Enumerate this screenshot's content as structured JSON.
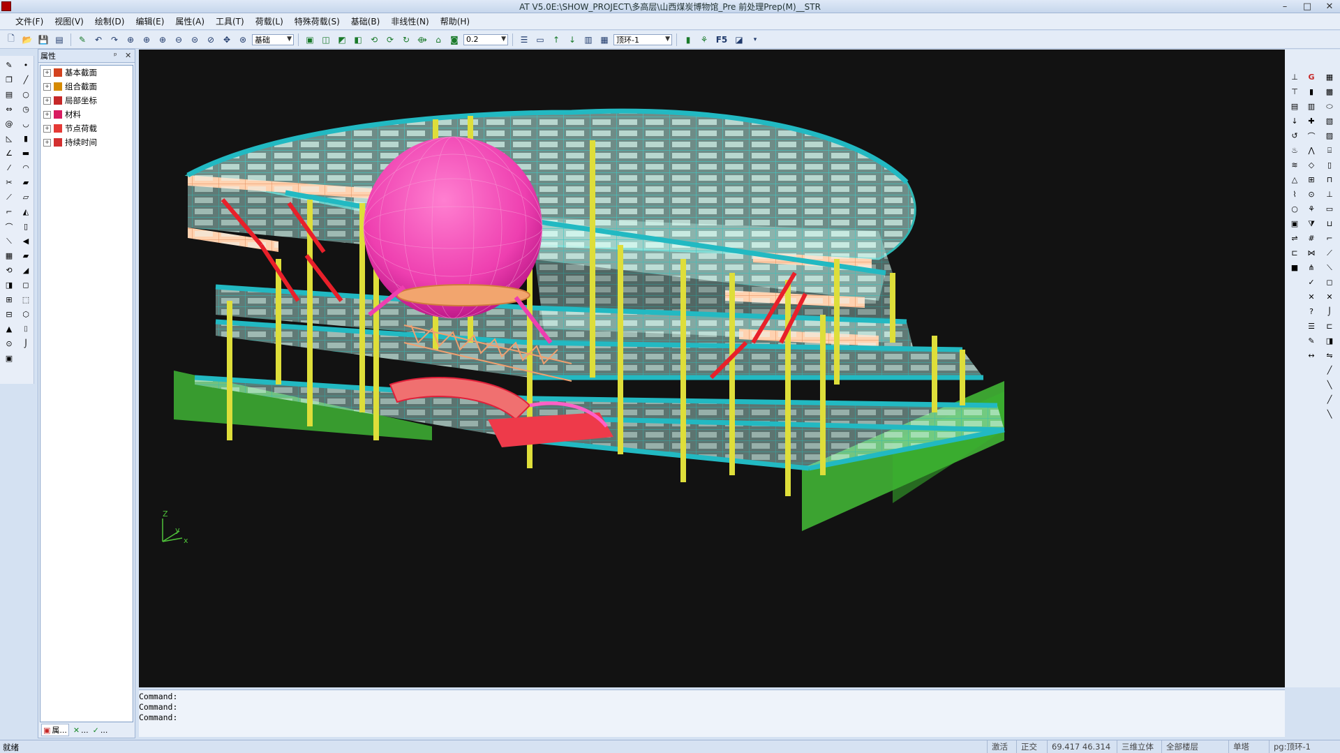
{
  "window": {
    "title": "AT V5.0E:\\SHOW_PROJECT\\多高层\\山西煤炭博物馆_Pre    前处理Prep(M)__STR",
    "controls": [
      "–",
      "□",
      "✕"
    ]
  },
  "menu": [
    "文件(F)",
    "视图(V)",
    "绘制(D)",
    "编辑(E)",
    "属性(A)",
    "工具(T)",
    "荷载(L)",
    "特殊荷载(S)",
    "基础(B)",
    "非线性(N)",
    "帮助(H)"
  ],
  "toolbar": {
    "view_combo": "基础",
    "scale_combo": "0.2",
    "floor_combo": "顶环-1",
    "f5_label": "F5"
  },
  "panel": {
    "title": "属性",
    "pin": "ᵖ",
    "close": "✕",
    "tree": [
      {
        "label": "基本截面",
        "icon_color": "#d3421e"
      },
      {
        "label": "组合截面",
        "icon_color": "#d68a00"
      },
      {
        "label": "局部坐标",
        "icon_color": "#c62828"
      },
      {
        "label": "材料",
        "icon_color": "#d81b60"
      },
      {
        "label": "节点荷载",
        "icon_color": "#e53935"
      },
      {
        "label": "持续时间",
        "icon_color": "#d32f2f"
      }
    ],
    "footer": [
      "属...",
      "...",
      "..."
    ]
  },
  "axis": {
    "z": "Z",
    "y": "y",
    "x": "x"
  },
  "command_lines": [
    "Command:",
    "Command:",
    "Command:"
  ],
  "status": {
    "left": "就绪",
    "cells": [
      "激活",
      "正交",
      "69.417  46.314",
      "三维立体",
      "全部楼层",
      "单塔",
      "pg:顶环-1"
    ]
  }
}
